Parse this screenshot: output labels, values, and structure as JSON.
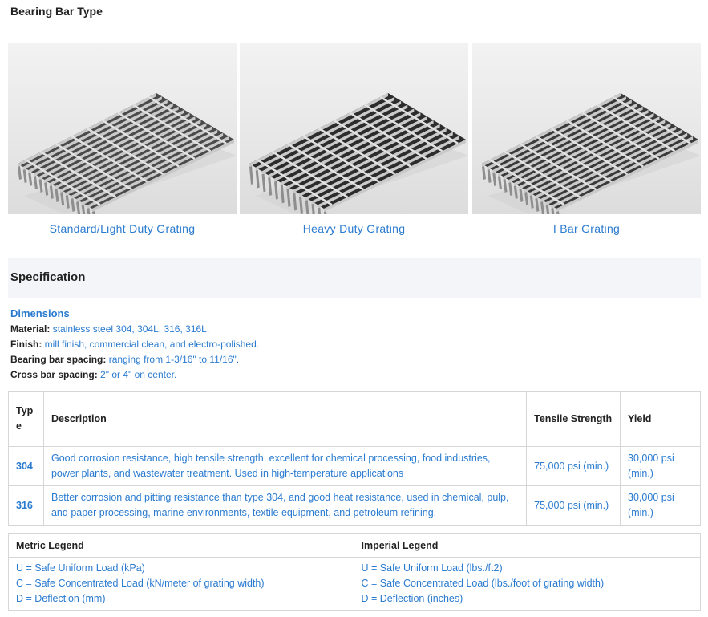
{
  "section_title": "Bearing Bar Type",
  "gallery": [
    {
      "caption": "Standard/Light Duty Grating",
      "icon": "grating-photo"
    },
    {
      "caption": "Heavy Duty Grating",
      "icon": "grating-photo"
    },
    {
      "caption": "I Bar Grating",
      "icon": "grating-photo"
    }
  ],
  "specification": {
    "title": "Specification",
    "dimensions_title": "Dimensions",
    "rows": [
      {
        "label": "Material:",
        "value": "stainless steel 304, 304L, 316, 316L."
      },
      {
        "label": "Finish:",
        "value": "mill finish, commercial clean, and electro-polished."
      },
      {
        "label": "Bearing bar spacing:",
        "value": "ranging from 1-3/16\" to 11/16\"."
      },
      {
        "label": "Cross bar spacing:",
        "value": "2\" or 4\" on center."
      }
    ]
  },
  "types_table": {
    "headers": [
      "Typ e",
      "Description",
      "Tensile Strength",
      "Yield"
    ],
    "rows": [
      {
        "type": "304",
        "description": "Good corrosion resistance, high tensile strength, excellent for chemical processing, food industries, power plants, and wastewater treatment. Used in high-temperature applications",
        "tensile": "75,000 psi (min.)",
        "yield": "30,000 psi (min.)"
      },
      {
        "type": "316",
        "description": "Better corrosion and pitting resistance than type 304, and good heat resistance, used in chemical, pulp, and paper processing, marine environments, textile equipment, and petroleum refining.",
        "tensile": "75,000 psi (min.)",
        "yield": "30,000 psi (min.)"
      }
    ]
  },
  "legend": {
    "metric_title": "Metric Legend",
    "imperial_title": "Imperial Legend",
    "metric": [
      "U = Safe Uniform Load (kPa)",
      "C = Safe Concentrated Load (kN/meter of grating width)",
      "D = Deflection (mm)"
    ],
    "imperial": [
      "U = Safe Uniform Load (lbs./ft2)",
      "C = Safe Concentrated Load (lbs./foot of grating width)",
      "D = Deflection (inches)"
    ]
  },
  "colors": {
    "accent": "#2a7bd0",
    "spec_bg": "#f3f5f8",
    "border": "#d6d6d6"
  }
}
